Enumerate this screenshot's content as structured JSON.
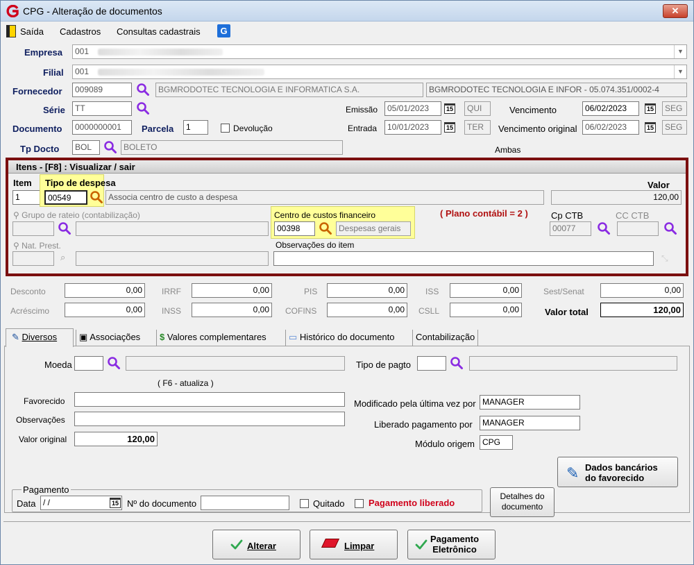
{
  "window": {
    "title": "CPG - Alteração de documentos",
    "close": "✕"
  },
  "menu": {
    "saida": "Saída",
    "cadastros": "Cadastros",
    "consultas": "Consultas cadastrais"
  },
  "header": {
    "empresa_label": "Empresa",
    "empresa_value": "001",
    "filial_label": "Filial",
    "filial_value": "001",
    "fornecedor_label": "Fornecedor",
    "fornecedor_code": "009089",
    "fornecedor_name": "BGMRODOTEC TECNOLOGIA E INFORMATICA S.A.",
    "fornecedor_detail": "BGMRODOTEC TECNOLOGIA E INFOR - 05.074.351/0002-4",
    "serie_label": "Série",
    "serie_value": "TT",
    "documento_label": "Documento",
    "documento_value": "0000000001",
    "parcela_label": "Parcela",
    "parcela_value": "1",
    "devolucao_label": "Devolução",
    "tpdocto_label": "Tp Docto",
    "tpdocto_code": "BOL",
    "tpdocto_name": "BOLETO",
    "emissao_label": "Emissão",
    "emissao_date": "05/01/2023",
    "emissao_day": "QUI",
    "entrada_label": "Entrada",
    "entrada_date": "10/01/2023",
    "entrada_day": "TER",
    "vencimento_label": "Vencimento",
    "vencimento_date": "06/02/2023",
    "vencimento_day": "SEG",
    "venc_orig_label": "Vencimento original",
    "venc_orig_date": "06/02/2023",
    "venc_orig_day": "SEG",
    "ambas": "Ambas",
    "cal_num": "15"
  },
  "itens": {
    "title": "Itens  - [F8] : Visualizar / sair",
    "item_label": "Item",
    "item_value": "1",
    "tipo_label": "Tipo de despesa",
    "tipo_code": "00549",
    "tipo_desc": "Associa centro de custo a despesa",
    "valor_label": "Valor",
    "valor_value": "120,00",
    "grupo_label": "Grupo de rateio (contabilização)",
    "ccf_label": "Centro de custos financeiro",
    "ccf_code": "00398",
    "ccf_desc": "Despesas gerais",
    "plano": "( Plano contábil = 2 )",
    "cpctb_label": "Cp CTB",
    "cpctb_value": "00077",
    "ccctb_label": "CC CTB",
    "nat_label": "Nat. Prest.",
    "obs_label": "Observações do item"
  },
  "totals": {
    "desconto_label": "Desconto",
    "desconto_value": "0,00",
    "acrescimo_label": "Acréscimo",
    "acrescimo_value": "0,00",
    "irrf_label": "IRRF",
    "irrf_value": "0,00",
    "inss_label": "INSS",
    "inss_value": "0,00",
    "pis_label": "PIS",
    "pis_value": "0,00",
    "cofins_label": "COFINS",
    "cofins_value": "0,00",
    "iss_label": "ISS",
    "iss_value": "0,00",
    "csll_label": "CSLL",
    "csll_value": "0,00",
    "sest_label": "Sest/Senat",
    "sest_value": "0,00",
    "total_label": "Valor total",
    "total_value": "120,00"
  },
  "tabs": [
    "Diversos",
    "Associações",
    "Valores complementares",
    "Histórico do documento",
    "Contabilização"
  ],
  "diversos": {
    "moeda_label": "Moeda",
    "tipopagto_label": "Tipo de pagto",
    "f6": "( F6 - atualiza )",
    "favorecido_label": "Favorecido",
    "observacoes_label": "Observações",
    "valor_original_label": "Valor original",
    "valor_original_value": "120,00",
    "modificado_label": "Modificado pela última vez por",
    "modificado_value": "MANAGER",
    "liberado_label": "Liberado pagamento por",
    "liberado_value": "MANAGER",
    "modulo_label": "Módulo origem",
    "modulo_value": "CPG",
    "dados_bancarios_1": "Dados bancários",
    "dados_bancarios_2": "do favorecido",
    "pagamento_group": "Pagamento",
    "data_label": "Data",
    "data_value": " /  /",
    "ndoc_label": "Nº do documento",
    "quitado_label": "Quitado",
    "pag_liberado_label": "Pagamento liberado",
    "detalhes_1": "Detalhes do",
    "detalhes_2": "documento"
  },
  "buttons": {
    "alterar": "Alterar",
    "limpar": "Limpar",
    "pag_eletr_1": "Pagamento",
    "pag_eletr_2": "Eletrônico"
  },
  "colors": {
    "accent": "#7b0f0f",
    "search": "#8a2be2",
    "yellow": "#ffff99",
    "red": "#d0021b",
    "navy": "#102060"
  }
}
